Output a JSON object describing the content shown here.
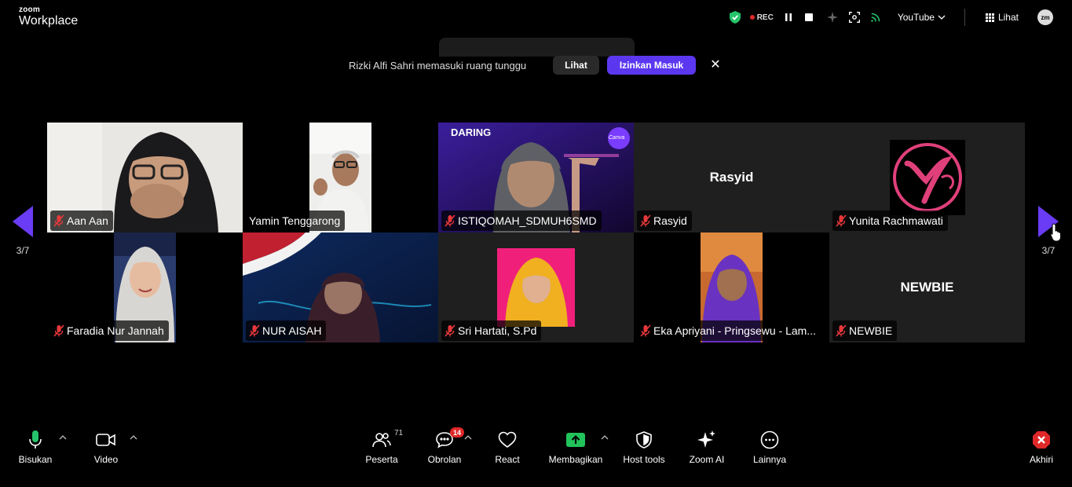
{
  "app": {
    "brand_top": "zoom",
    "brand_bottom": "Workplace"
  },
  "top_bar": {
    "rec_label": "REC",
    "stream_label": "YouTube",
    "view_label": "Lihat",
    "avatar_label": "zm",
    "icons": [
      "shield-check-icon",
      "pause-icon",
      "stop-icon",
      "sparkle-icon",
      "focus-icon",
      "live-signal-icon",
      "chevron-down-icon",
      "grid-icon"
    ]
  },
  "waiting_notice": {
    "message": "Rizki Alfi Sahri memasuki ruang tunggu",
    "view_button": "Lihat",
    "admit_button": "Izinkan Masuk"
  },
  "participants": [
    {
      "name": "Aan Aan",
      "muted": true
    },
    {
      "name": "Yamin Tenggarong",
      "muted": false
    },
    {
      "name": "ISTIQOMAH_SDMUH6SMD",
      "muted": true
    },
    {
      "name": "Rasyid",
      "muted": true,
      "center_label": "Rasyid"
    },
    {
      "name": "Yunita Rachmawati",
      "muted": true
    },
    {
      "name": "Faradia Nur Jannah",
      "muted": true
    },
    {
      "name": "NUR AISAH",
      "muted": true
    },
    {
      "name": "Sri Hartati, S.Pd",
      "muted": true
    },
    {
      "name": "Eka Apriyani - Pringsewu - Lam...",
      "muted": true
    },
    {
      "name": "NEWBIE",
      "muted": true,
      "center_label": "NEWBIE"
    }
  ],
  "tile_banners": {
    "daring": "DARING",
    "canva": "Canva"
  },
  "pager": {
    "left_page": "3/7",
    "right_page": "3/7"
  },
  "toolbar": {
    "mic": "Bisukan",
    "video": "Video",
    "participants": "Peserta",
    "participants_count": "71",
    "chat": "Obrolan",
    "chat_badge": "14",
    "react": "React",
    "share": "Membagikan",
    "host_tools": "Host tools",
    "zoom_ai": "Zoom AI",
    "more": "Lainnya",
    "end": "Akhiri"
  },
  "colors": {
    "accent_purple": "#5b38f0",
    "pager_arrow": "#6a3cf5",
    "rec_red": "#e02828",
    "mute_red": "#e8383a",
    "mic_green": "#25c46a",
    "share_green": "#21c35b",
    "tile_bg": "#1f1f1f"
  }
}
